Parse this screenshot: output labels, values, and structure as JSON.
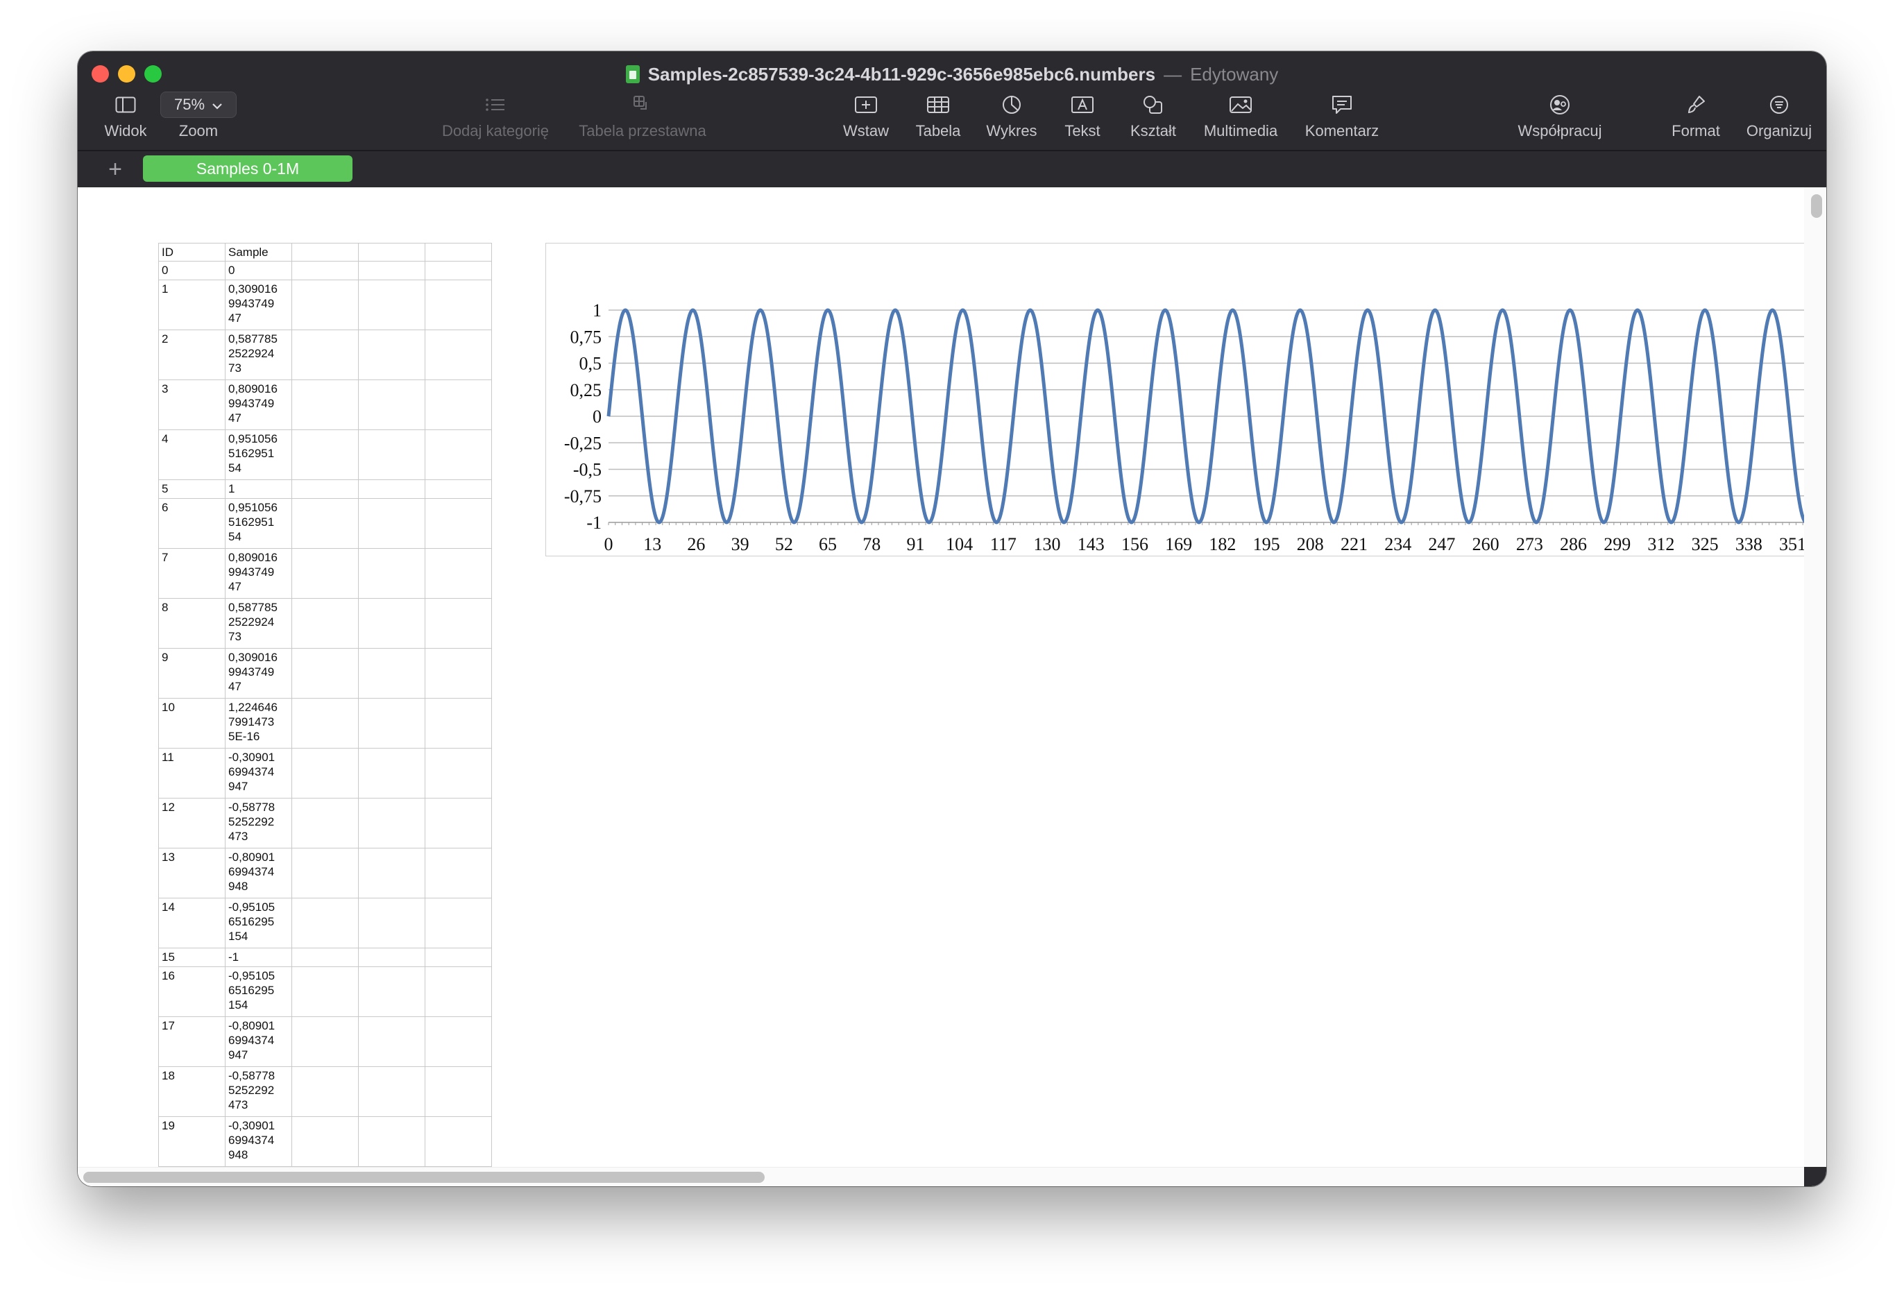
{
  "window": {
    "title": "Samples-2c857539-3c24-4b11-929c-3656e985ebc6.numbers",
    "separator": "—",
    "state": "Edytowany"
  },
  "toolbar": {
    "view_label": "Widok",
    "zoom_value": "75%",
    "zoom_label": "Zoom",
    "add_category_label": "Dodaj kategorię",
    "pivot_label": "Tabela przestawna",
    "insert_label": "Wstaw",
    "table_label": "Tabela",
    "chart_label": "Wykres",
    "text_label": "Tekst",
    "shape_label": "Kształt",
    "media_label": "Multimedia",
    "comment_label": "Komentarz",
    "collaborate_label": "Współpracuj",
    "format_label": "Format",
    "organize_label": "Organizuj"
  },
  "tabs": {
    "add_label": "+",
    "sheets": [
      {
        "label": "Samples 0-1M"
      }
    ]
  },
  "table": {
    "headers": [
      "ID",
      "Sample",
      "",
      "",
      ""
    ],
    "rows": [
      [
        "0",
        "0"
      ],
      [
        "1",
        "0,309016\n9943749\n47"
      ],
      [
        "2",
        "0,587785\n2522924\n73"
      ],
      [
        "3",
        "0,809016\n9943749\n47"
      ],
      [
        "4",
        "0,951056\n5162951\n54"
      ],
      [
        "5",
        "1"
      ],
      [
        "6",
        "0,951056\n5162951\n54"
      ],
      [
        "7",
        "0,809016\n9943749\n47"
      ],
      [
        "8",
        "0,587785\n2522924\n73"
      ],
      [
        "9",
        "0,309016\n9943749\n47"
      ],
      [
        "10",
        "1,224646\n7991473\n5E-16"
      ],
      [
        "11",
        "-0,30901\n6994374\n947"
      ],
      [
        "12",
        "-0,58778\n5252292\n473"
      ],
      [
        "13",
        "-0,80901\n6994374\n948"
      ],
      [
        "14",
        "-0,95105\n6516295\n154"
      ],
      [
        "15",
        "-1"
      ],
      [
        "16",
        "-0,95105\n6516295\n154"
      ],
      [
        "17",
        "-0,80901\n6994374\n947"
      ],
      [
        "18",
        "-0,58778\n5252292\n473"
      ],
      [
        "19",
        "-0,30901\n6994374\n948"
      ]
    ]
  },
  "chart_data": {
    "type": "line",
    "function": "sin(2*pi*x/20)",
    "x_range": [
      0,
      355
    ],
    "ylim": [
      -1,
      1
    ],
    "y_ticks": [
      "1",
      "0,75",
      "0,5",
      "0,25",
      "0",
      "-0,25",
      "-0,5",
      "-0,75",
      "-1"
    ],
    "y_tick_values": [
      1,
      0.75,
      0.5,
      0.25,
      0,
      -0.25,
      -0.5,
      -0.75,
      -1
    ],
    "x_ticks": [
      0,
      13,
      26,
      39,
      52,
      65,
      78,
      91,
      104,
      117,
      130,
      143,
      156,
      169,
      182,
      195,
      208,
      221,
      234,
      247,
      260,
      273,
      286,
      299,
      312,
      325,
      338,
      351
    ],
    "grid": true,
    "line_color": "#4f7ab3",
    "title": "",
    "xlabel": "",
    "ylabel": ""
  },
  "colors": {
    "toolbar_bg": "#2b2a2f",
    "sheet_tab": "#5cc65a",
    "close": "#fe5f57",
    "minimize": "#febc2e",
    "zoom": "#28c840"
  }
}
